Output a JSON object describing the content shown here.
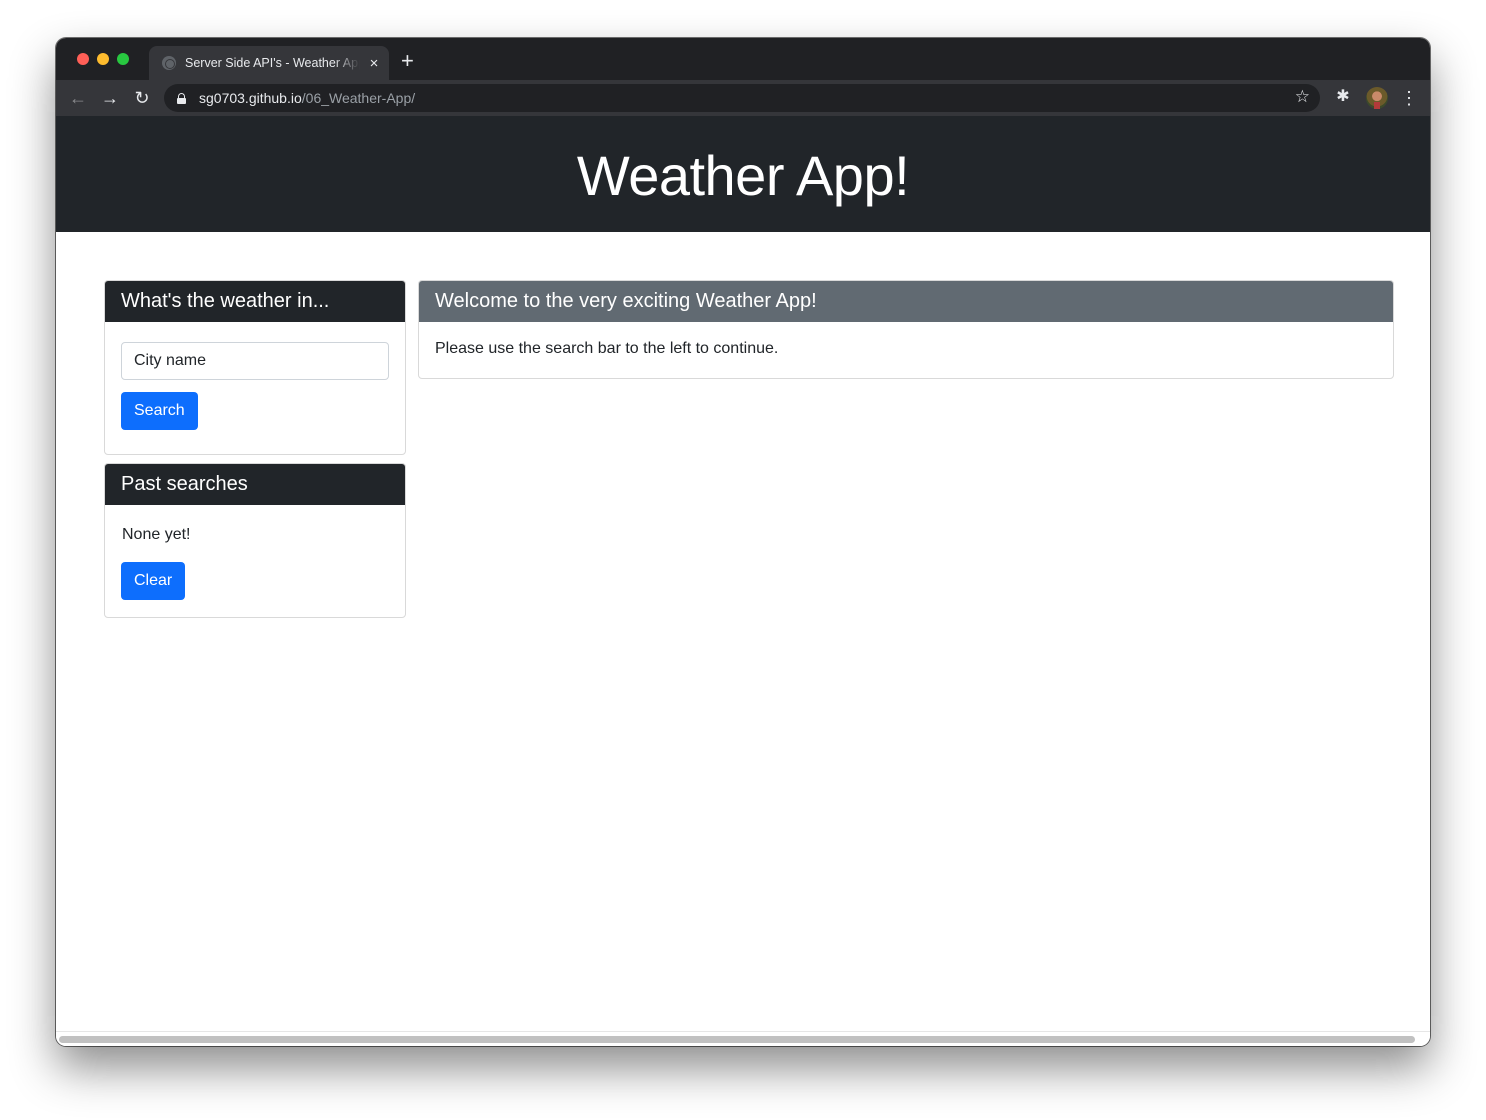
{
  "browser": {
    "tab": {
      "title": "Server Side API's - Weather App",
      "favicon": "globe-icon",
      "close_icon": "×"
    },
    "new_tab_icon": "+",
    "nav": {
      "back_icon": "←",
      "forward_icon": "→",
      "reload_icon": "↻"
    },
    "address_bar": {
      "domain": "sg0703.github.io",
      "path": "/06_Weather-App/"
    },
    "bookmark_icon": "☆",
    "extensions_icon": "✱",
    "menu_icon": "⋮"
  },
  "page": {
    "header": {
      "title": "Weather App!"
    },
    "search_card": {
      "title": "What's the weather in...",
      "input_placeholder": "City name",
      "input_value": "",
      "search_label": "Search"
    },
    "past_card": {
      "title": "Past searches",
      "empty_text": "None yet!",
      "clear_label": "Clear"
    },
    "welcome_card": {
      "title": "Welcome to the very exciting Weather App!",
      "body": "Please use the search bar to the left to continue."
    }
  },
  "colors": {
    "primary": "#0d6efd",
    "dark": "#212529",
    "secondary": "#616a72"
  }
}
